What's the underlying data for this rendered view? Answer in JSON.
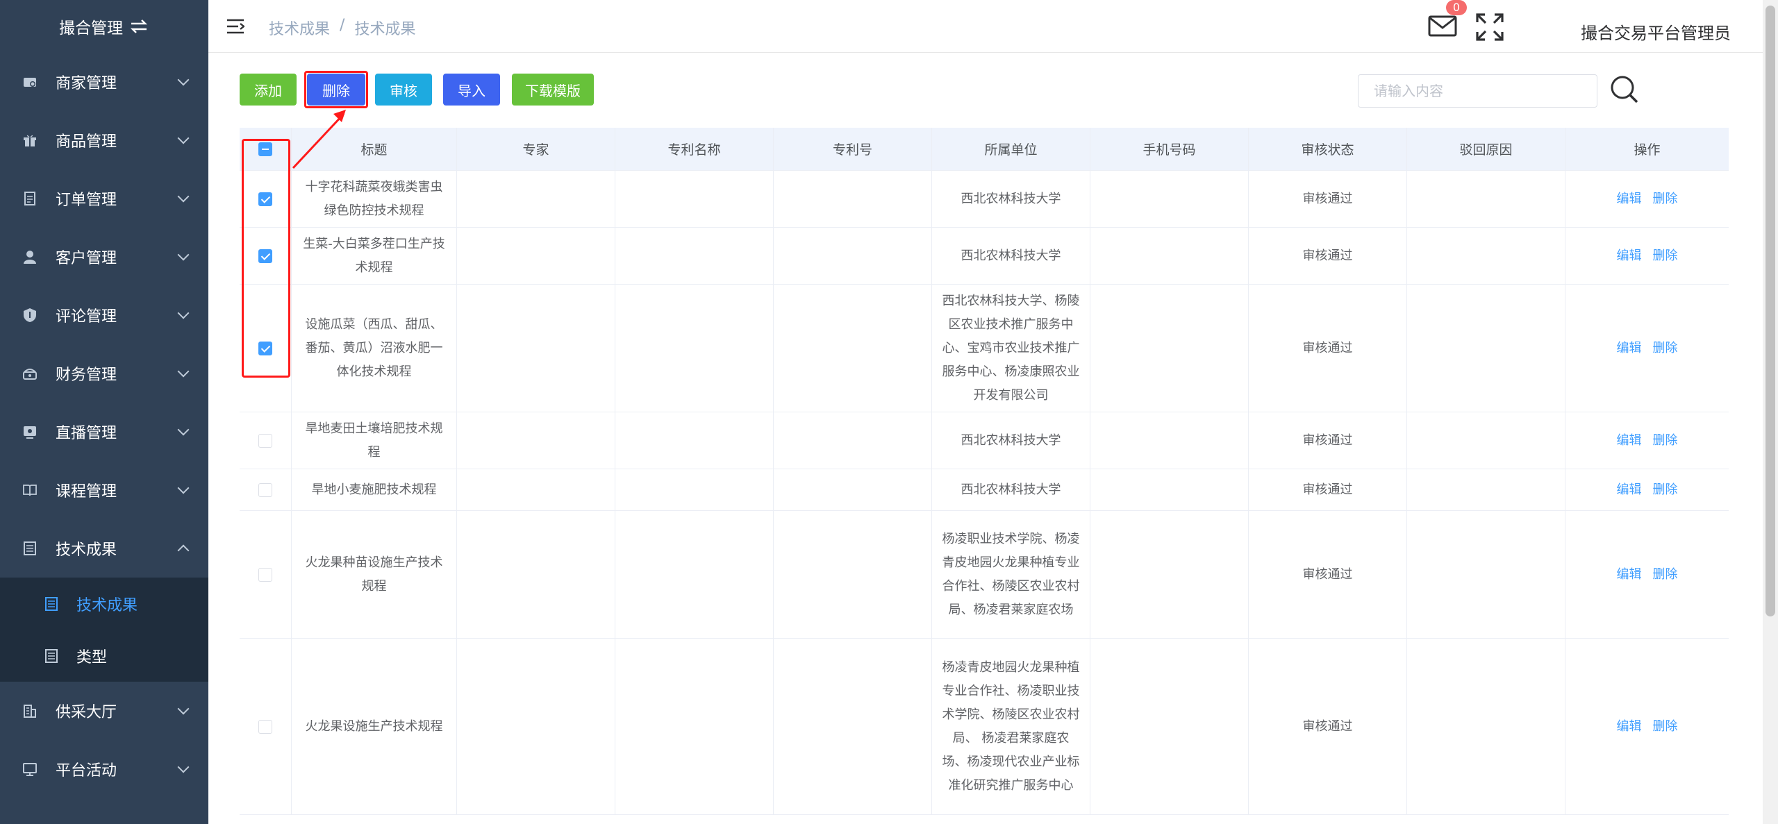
{
  "sidebar": {
    "title": "撮合管理",
    "menu": [
      {
        "label": "商家管理",
        "icon": "store-icon"
      },
      {
        "label": "商品管理",
        "icon": "gift-icon"
      },
      {
        "label": "订单管理",
        "icon": "document-icon"
      },
      {
        "label": "客户管理",
        "icon": "user-icon"
      },
      {
        "label": "评论管理",
        "icon": "shield-icon"
      },
      {
        "label": "财务管理",
        "icon": "wallet-icon"
      },
      {
        "label": "直播管理",
        "icon": "broadcast-icon"
      },
      {
        "label": "课程管理",
        "icon": "book-icon"
      },
      {
        "label": "技术成果",
        "icon": "clipboard-icon"
      }
    ],
    "submenu": [
      {
        "label": "技术成果",
        "icon": "clipboard-icon"
      },
      {
        "label": "类型",
        "icon": "clipboard-icon"
      }
    ],
    "menu_after": [
      {
        "label": "供采大厅",
        "icon": "building-icon"
      },
      {
        "label": "平台活动",
        "icon": "monitor-icon"
      }
    ]
  },
  "header": {
    "breadcrumb": [
      "技术成果",
      "/",
      "技术成果"
    ],
    "mail_badge": "0",
    "username": "撮合交易平台管理员"
  },
  "toolbar": {
    "add": "添加",
    "delete": "删除",
    "audit": "审核",
    "import": "导入",
    "download_template": "下载模版",
    "search_placeholder": "请输入内容"
  },
  "table": {
    "headers": [
      "",
      "标题",
      "专家",
      "专利名称",
      "专利号",
      "所属单位",
      "手机号码",
      "审核状态",
      "驳回原因",
      "操作"
    ],
    "edit_label": "编辑",
    "delete_label": "删除",
    "rows": [
      {
        "checked": true,
        "title": "十字花科蔬菜夜蛾类害虫绿色防控技术规程",
        "expert": "",
        "patent_name": "",
        "patent_no": "",
        "unit": "西北农林科技大学",
        "phone": "",
        "status": "审核通过",
        "reason": ""
      },
      {
        "checked": true,
        "title": "生菜-大白菜多茬口生产技术规程",
        "expert": "",
        "patent_name": "",
        "patent_no": "",
        "unit": "西北农林科技大学",
        "phone": "",
        "status": "审核通过",
        "reason": ""
      },
      {
        "checked": true,
        "title": "设施瓜菜（西瓜、甜瓜、番茄、黄瓜）沼液水肥一体化技术规程",
        "expert": "",
        "patent_name": "",
        "patent_no": "",
        "unit": "西北农林科技大学、杨陵区农业技术推广服务中心、宝鸡市农业技术推广服务中心、杨凌康照农业开发有限公司",
        "phone": "",
        "status": "审核通过",
        "reason": ""
      },
      {
        "checked": false,
        "title": "旱地麦田土壤培肥技术规程",
        "expert": "",
        "patent_name": "",
        "patent_no": "",
        "unit": "西北农林科技大学",
        "phone": "",
        "status": "审核通过",
        "reason": ""
      },
      {
        "checked": false,
        "title": "旱地小麦施肥技术规程",
        "expert": "",
        "patent_name": "",
        "patent_no": "",
        "unit": "西北农林科技大学",
        "phone": "",
        "status": "审核通过",
        "reason": ""
      },
      {
        "checked": false,
        "title": "火龙果种苗设施生产技术规程",
        "expert": "",
        "patent_name": "",
        "patent_no": "",
        "unit": "杨凌职业技术学院、杨凌青皮地园火龙果种植专业合作社、杨陵区农业农村局、杨凌君莱家庭农场",
        "phone": "",
        "status": "审核通过",
        "reason": ""
      },
      {
        "checked": false,
        "title": "火龙果设施生产技术规程",
        "expert": "",
        "patent_name": "",
        "patent_no": "",
        "unit": "杨凌青皮地园火龙果种植专业合作社、杨凌职业技术学院、杨陵区农业农村局、 杨凌君莱家庭农场、杨凌现代农业产业标准化研究推广服务中心",
        "phone": "",
        "status": "审核通过",
        "reason": ""
      }
    ]
  }
}
